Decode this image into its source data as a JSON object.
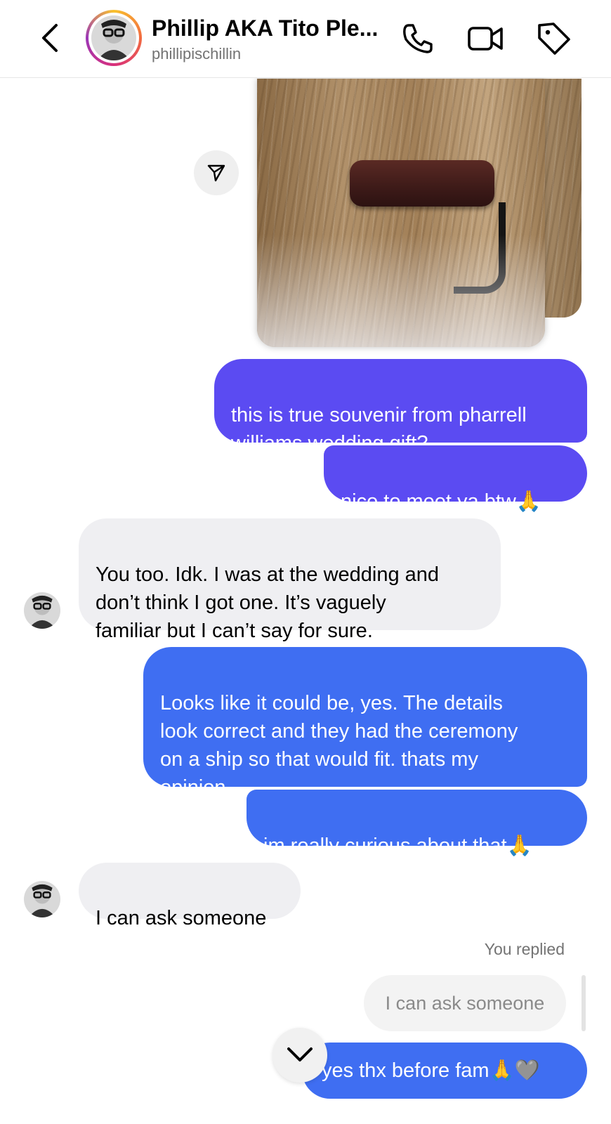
{
  "header": {
    "name": "Phillip AKA Tito Ple...",
    "username": "phillipischillin",
    "icons": {
      "back": "chevron-left-icon",
      "call": "phone-icon",
      "video": "video-camera-icon",
      "tag": "tag-icon"
    }
  },
  "messages": [
    {
      "side": "out",
      "text": "this is true souvenir from pharrell\nwilliams wedding gift?"
    },
    {
      "side": "out",
      "text": "nice to meet ya btw",
      "emoji": "🙏"
    },
    {
      "side": "in",
      "text": "You too. Idk. I was at the wedding and\ndon’t think I got one. It’s vaguely\nfamiliar but I can’t say for sure."
    },
    {
      "side": "out",
      "text": "Looks like it could be, yes. The details\nlook correct and they had the ceremony\non a ship so that would fit. thats my\nopinion"
    },
    {
      "side": "out",
      "text": "im really curious about that",
      "emoji": "🙏"
    },
    {
      "side": "in",
      "text": "I can ask someone"
    }
  ],
  "reply": {
    "label": "You replied",
    "quoted": "I can ask someone",
    "text": "yes thx before fam",
    "emoji": "🙏🩶"
  },
  "colors": {
    "purple_bubble": "#5b4bf2",
    "blue_bubble": "#3f6ef2",
    "incoming_bubble": "#efeff2"
  }
}
